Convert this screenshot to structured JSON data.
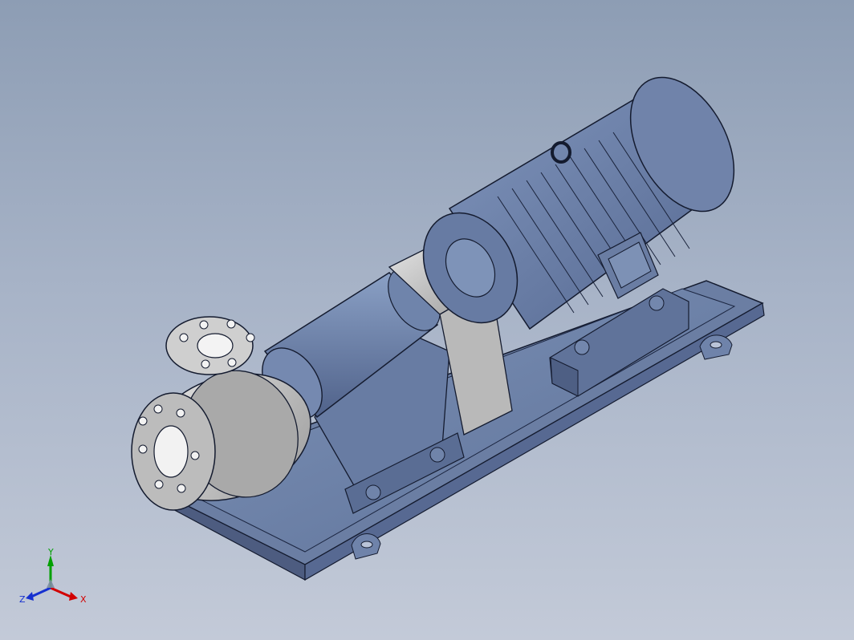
{
  "colors": {
    "background_top": "#8d9db4",
    "background_bottom": "#c3cad8",
    "part_blue": "#64789c",
    "part_light": "#c9c9c9",
    "edge": "#121a2d",
    "axis_x": "#d20000",
    "axis_y": "#00a000",
    "axis_z": "#1630d0"
  },
  "view": {
    "triad": {
      "x_label": "X",
      "y_label": "Y",
      "z_label": "Z"
    }
  },
  "icons": {
    "pump_model": "centrifugal-pump-assembly",
    "triad": "coordinate-axis-triad"
  }
}
